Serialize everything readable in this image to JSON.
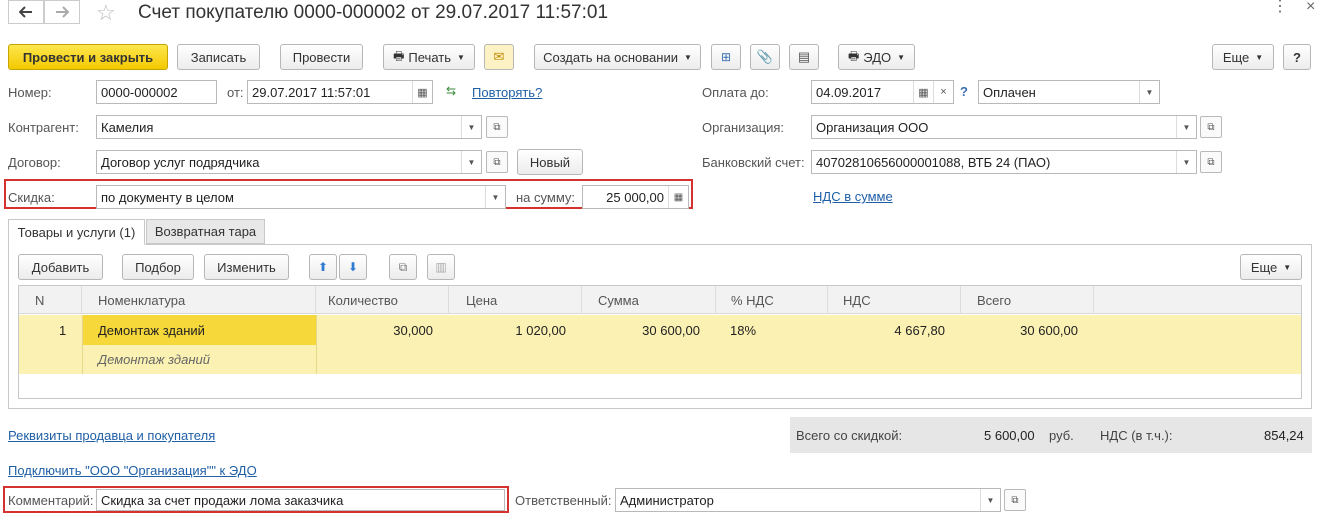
{
  "title": "Счет покупателю 0000-000002 от 29.07.2017 11:57:01",
  "icons": {
    "back": "arrow-left-icon",
    "forward": "arrow-right-icon",
    "star": "star-icon",
    "more": "more-icon",
    "close": "close-icon"
  },
  "toolbar": {
    "post_close": "Провести и закрыть",
    "save": "Записать",
    "post": "Провести",
    "print": "Печать",
    "create_based": "Создать на основании",
    "edo": "ЭДО",
    "more": "Еще",
    "help": "?"
  },
  "form": {
    "number_label": "Номер:",
    "number": "0000-000002",
    "from_label": "от:",
    "date": "29.07.2017 11:57:01",
    "repeat": "Повторять?",
    "pay_until_label": "Оплата до:",
    "pay_until": "04.09.2017",
    "status": "Оплачен",
    "contractor_label": "Контрагент:",
    "contractor": "Камелия",
    "org_label": "Организация:",
    "org": "Организация ООО",
    "contract_label": "Договор:",
    "contract": "Договор услуг подрядчика",
    "new_btn": "Новый",
    "bank_label": "Банковский счет:",
    "bank": "40702810656000001088, ВТБ 24 (ПАО)",
    "discount_label": "Скидка:",
    "discount": "по документу в целом",
    "sum_label": "на сумму:",
    "sum": "25 000,00",
    "vat_link": "НДС в сумме"
  },
  "tabs": [
    "Товары и услуги (1)",
    "Возвратная тара"
  ],
  "table_toolbar": {
    "add": "Добавить",
    "pick": "Подбор",
    "change": "Изменить",
    "more": "Еще"
  },
  "table": {
    "headers": [
      "N",
      "Номенклатура",
      "Количество",
      "Цена",
      "Сумма",
      "% НДС",
      "НДС",
      "Всего"
    ],
    "rows": [
      {
        "n": "1",
        "name": "Демонтаж зданий",
        "name2": "Демонтаж зданий",
        "qty": "30,000",
        "price": "1 020,00",
        "sum": "30 600,00",
        "vat_rate": "18%",
        "vat": "4 667,80",
        "total": "30 600,00"
      }
    ]
  },
  "footer": {
    "requisites": "Реквизиты продавца и покупателя",
    "edo_link": "Подключить \"ООО \"Организация\"\" к ЭДО",
    "total_discount_label": "Всего со скидкой:",
    "total_discount": "5 600,00",
    "currency": "руб.",
    "vat_incl_label": "НДС (в т.ч.):",
    "vat_incl": "854,24",
    "comment_label": "Комментарий:",
    "comment": "Скидка за счет продажи лома заказчика",
    "responsible_label": "Ответственный:",
    "responsible": "Администратор"
  }
}
